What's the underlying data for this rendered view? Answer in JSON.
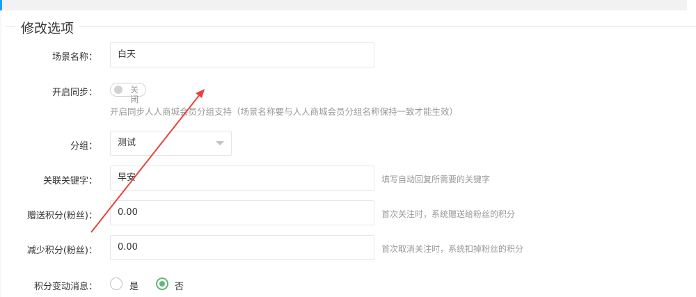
{
  "form": {
    "legend": "修改选项",
    "scene_name": {
      "label": "场景名称：",
      "value": "白天"
    },
    "sync": {
      "label": "开启同步：",
      "toggle_text": "关闭",
      "hint": "开启同步人人商城会员分组支持（场景名称要与人人商城会员分组名称保持一致才能生效）"
    },
    "group": {
      "label": "分组：",
      "value": "测试"
    },
    "keyword": {
      "label": "关联关键字：",
      "value": "早安",
      "hint": "填写自动回复所需要的关键字"
    },
    "gift_points": {
      "label": "赠送积分(粉丝)：",
      "value": "0.00",
      "hint": "首次关注时，系统赠送给粉丝的积分"
    },
    "reduce_points": {
      "label": "减少积分(粉丝)：",
      "value": "0.00",
      "hint": "首次取消关注时，系统扣掉粉丝的积分"
    },
    "points_message": {
      "label": "积分变动消息：",
      "options": [
        {
          "label": "是",
          "checked": false
        },
        {
          "label": "否",
          "checked": true
        }
      ]
    }
  },
  "colors": {
    "accent": "#1e9fff",
    "radio_checked": "#5fb878",
    "annotation_arrow": "#e8413c",
    "hint_text": "#999999"
  }
}
